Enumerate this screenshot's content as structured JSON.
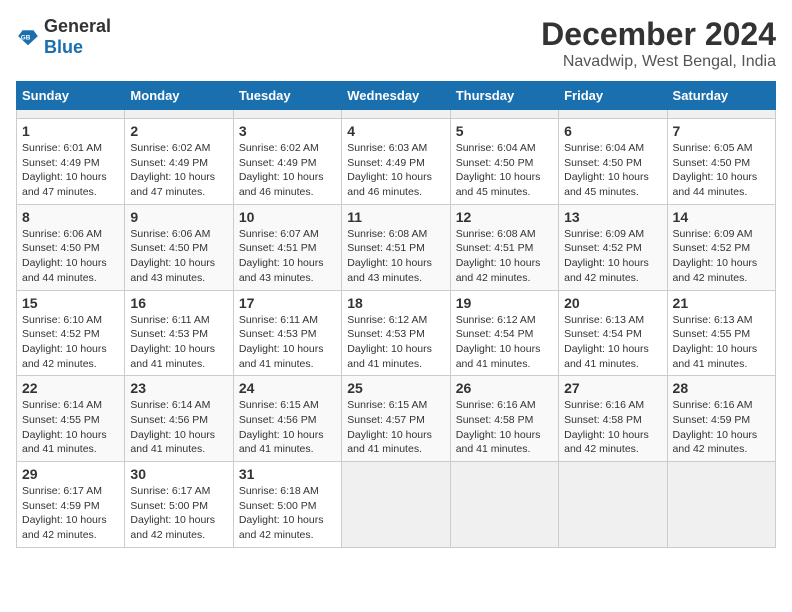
{
  "header": {
    "logo_general": "General",
    "logo_blue": "Blue",
    "title": "December 2024",
    "subtitle": "Navadwip, West Bengal, India"
  },
  "calendar": {
    "days_of_week": [
      "Sunday",
      "Monday",
      "Tuesday",
      "Wednesday",
      "Thursday",
      "Friday",
      "Saturday"
    ],
    "weeks": [
      [
        {
          "day": "",
          "empty": true
        },
        {
          "day": "",
          "empty": true
        },
        {
          "day": "",
          "empty": true
        },
        {
          "day": "",
          "empty": true
        },
        {
          "day": "",
          "empty": true
        },
        {
          "day": "",
          "empty": true
        },
        {
          "day": "",
          "empty": true
        }
      ],
      [
        {
          "day": "1",
          "sunrise": "Sunrise: 6:01 AM",
          "sunset": "Sunset: 4:49 PM",
          "daylight": "Daylight: 10 hours and 47 minutes."
        },
        {
          "day": "2",
          "sunrise": "Sunrise: 6:02 AM",
          "sunset": "Sunset: 4:49 PM",
          "daylight": "Daylight: 10 hours and 47 minutes."
        },
        {
          "day": "3",
          "sunrise": "Sunrise: 6:02 AM",
          "sunset": "Sunset: 4:49 PM",
          "daylight": "Daylight: 10 hours and 46 minutes."
        },
        {
          "day": "4",
          "sunrise": "Sunrise: 6:03 AM",
          "sunset": "Sunset: 4:49 PM",
          "daylight": "Daylight: 10 hours and 46 minutes."
        },
        {
          "day": "5",
          "sunrise": "Sunrise: 6:04 AM",
          "sunset": "Sunset: 4:50 PM",
          "daylight": "Daylight: 10 hours and 45 minutes."
        },
        {
          "day": "6",
          "sunrise": "Sunrise: 6:04 AM",
          "sunset": "Sunset: 4:50 PM",
          "daylight": "Daylight: 10 hours and 45 minutes."
        },
        {
          "day": "7",
          "sunrise": "Sunrise: 6:05 AM",
          "sunset": "Sunset: 4:50 PM",
          "daylight": "Daylight: 10 hours and 44 minutes."
        }
      ],
      [
        {
          "day": "8",
          "sunrise": "Sunrise: 6:06 AM",
          "sunset": "Sunset: 4:50 PM",
          "daylight": "Daylight: 10 hours and 44 minutes."
        },
        {
          "day": "9",
          "sunrise": "Sunrise: 6:06 AM",
          "sunset": "Sunset: 4:50 PM",
          "daylight": "Daylight: 10 hours and 43 minutes."
        },
        {
          "day": "10",
          "sunrise": "Sunrise: 6:07 AM",
          "sunset": "Sunset: 4:51 PM",
          "daylight": "Daylight: 10 hours and 43 minutes."
        },
        {
          "day": "11",
          "sunrise": "Sunrise: 6:08 AM",
          "sunset": "Sunset: 4:51 PM",
          "daylight": "Daylight: 10 hours and 43 minutes."
        },
        {
          "day": "12",
          "sunrise": "Sunrise: 6:08 AM",
          "sunset": "Sunset: 4:51 PM",
          "daylight": "Daylight: 10 hours and 42 minutes."
        },
        {
          "day": "13",
          "sunrise": "Sunrise: 6:09 AM",
          "sunset": "Sunset: 4:52 PM",
          "daylight": "Daylight: 10 hours and 42 minutes."
        },
        {
          "day": "14",
          "sunrise": "Sunrise: 6:09 AM",
          "sunset": "Sunset: 4:52 PM",
          "daylight": "Daylight: 10 hours and 42 minutes."
        }
      ],
      [
        {
          "day": "15",
          "sunrise": "Sunrise: 6:10 AM",
          "sunset": "Sunset: 4:52 PM",
          "daylight": "Daylight: 10 hours and 42 minutes."
        },
        {
          "day": "16",
          "sunrise": "Sunrise: 6:11 AM",
          "sunset": "Sunset: 4:53 PM",
          "daylight": "Daylight: 10 hours and 41 minutes."
        },
        {
          "day": "17",
          "sunrise": "Sunrise: 6:11 AM",
          "sunset": "Sunset: 4:53 PM",
          "daylight": "Daylight: 10 hours and 41 minutes."
        },
        {
          "day": "18",
          "sunrise": "Sunrise: 6:12 AM",
          "sunset": "Sunset: 4:53 PM",
          "daylight": "Daylight: 10 hours and 41 minutes."
        },
        {
          "day": "19",
          "sunrise": "Sunrise: 6:12 AM",
          "sunset": "Sunset: 4:54 PM",
          "daylight": "Daylight: 10 hours and 41 minutes."
        },
        {
          "day": "20",
          "sunrise": "Sunrise: 6:13 AM",
          "sunset": "Sunset: 4:54 PM",
          "daylight": "Daylight: 10 hours and 41 minutes."
        },
        {
          "day": "21",
          "sunrise": "Sunrise: 6:13 AM",
          "sunset": "Sunset: 4:55 PM",
          "daylight": "Daylight: 10 hours and 41 minutes."
        }
      ],
      [
        {
          "day": "22",
          "sunrise": "Sunrise: 6:14 AM",
          "sunset": "Sunset: 4:55 PM",
          "daylight": "Daylight: 10 hours and 41 minutes."
        },
        {
          "day": "23",
          "sunrise": "Sunrise: 6:14 AM",
          "sunset": "Sunset: 4:56 PM",
          "daylight": "Daylight: 10 hours and 41 minutes."
        },
        {
          "day": "24",
          "sunrise": "Sunrise: 6:15 AM",
          "sunset": "Sunset: 4:56 PM",
          "daylight": "Daylight: 10 hours and 41 minutes."
        },
        {
          "day": "25",
          "sunrise": "Sunrise: 6:15 AM",
          "sunset": "Sunset: 4:57 PM",
          "daylight": "Daylight: 10 hours and 41 minutes."
        },
        {
          "day": "26",
          "sunrise": "Sunrise: 6:16 AM",
          "sunset": "Sunset: 4:58 PM",
          "daylight": "Daylight: 10 hours and 41 minutes."
        },
        {
          "day": "27",
          "sunrise": "Sunrise: 6:16 AM",
          "sunset": "Sunset: 4:58 PM",
          "daylight": "Daylight: 10 hours and 42 minutes."
        },
        {
          "day": "28",
          "sunrise": "Sunrise: 6:16 AM",
          "sunset": "Sunset: 4:59 PM",
          "daylight": "Daylight: 10 hours and 42 minutes."
        }
      ],
      [
        {
          "day": "29",
          "sunrise": "Sunrise: 6:17 AM",
          "sunset": "Sunset: 4:59 PM",
          "daylight": "Daylight: 10 hours and 42 minutes."
        },
        {
          "day": "30",
          "sunrise": "Sunrise: 6:17 AM",
          "sunset": "Sunset: 5:00 PM",
          "daylight": "Daylight: 10 hours and 42 minutes."
        },
        {
          "day": "31",
          "sunrise": "Sunrise: 6:18 AM",
          "sunset": "Sunset: 5:00 PM",
          "daylight": "Daylight: 10 hours and 42 minutes."
        },
        {
          "day": "",
          "empty": true
        },
        {
          "day": "",
          "empty": true
        },
        {
          "day": "",
          "empty": true
        },
        {
          "day": "",
          "empty": true
        }
      ]
    ]
  }
}
